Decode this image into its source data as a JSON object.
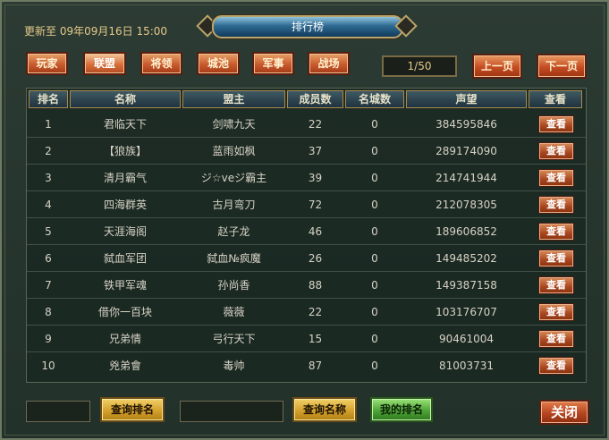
{
  "header": {
    "update_text": "更新至 09年09月16日 15:00",
    "title": "排行榜"
  },
  "tabs": [
    {
      "label": "玩家",
      "active": false
    },
    {
      "label": "联盟",
      "active": true
    },
    {
      "label": "将领",
      "active": false
    },
    {
      "label": "城池",
      "active": false
    },
    {
      "label": "军事",
      "active": false
    },
    {
      "label": "战场",
      "active": false
    }
  ],
  "pager": {
    "indicator": "1/50",
    "prev_label": "上一页",
    "next_label": "下一页"
  },
  "table": {
    "columns": [
      "排名",
      "名称",
      "盟主",
      "成员数",
      "名城数",
      "声望",
      "查看"
    ],
    "rows": [
      {
        "rank": "1",
        "name": "君临天下",
        "leader": "剑啸九天",
        "members": "22",
        "cities": "0",
        "prestige": "384595846",
        "view": "查看"
      },
      {
        "rank": "2",
        "name": "【狼族】",
        "leader": "蓝雨如枫",
        "members": "37",
        "cities": "0",
        "prestige": "289174090",
        "view": "查看"
      },
      {
        "rank": "3",
        "name": "清月霸气",
        "leader": "ジ☆veジ霸主",
        "members": "39",
        "cities": "0",
        "prestige": "214741944",
        "view": "查看"
      },
      {
        "rank": "4",
        "name": "四海群英",
        "leader": "古月弯刀",
        "members": "72",
        "cities": "0",
        "prestige": "212078305",
        "view": "查看"
      },
      {
        "rank": "5",
        "name": "天涯海阁",
        "leader": "赵子龙",
        "members": "46",
        "cities": "0",
        "prestige": "189606852",
        "view": "查看"
      },
      {
        "rank": "6",
        "name": "弑血军团",
        "leader": "弑血№疯魔",
        "members": "26",
        "cities": "0",
        "prestige": "149485202",
        "view": "查看"
      },
      {
        "rank": "7",
        "name": "铁甲军魂",
        "leader": "孙尚香",
        "members": "88",
        "cities": "0",
        "prestige": "149387158",
        "view": "查看"
      },
      {
        "rank": "8",
        "name": "借你一百块",
        "leader": "薇薇",
        "members": "22",
        "cities": "0",
        "prestige": "103176707",
        "view": "查看"
      },
      {
        "rank": "9",
        "name": "兄弟情",
        "leader": "弓行天下",
        "members": "15",
        "cities": "0",
        "prestige": "90461004",
        "view": "查看"
      },
      {
        "rank": "10",
        "name": "兇弟會",
        "leader": "毒帅",
        "members": "87",
        "cities": "0",
        "prestige": "81003731",
        "view": "查看"
      }
    ]
  },
  "footer": {
    "query_rank_label": "查询排名",
    "query_name_label": "查询名称",
    "my_rank_label": "我的排名",
    "close_label": "关闭"
  }
}
